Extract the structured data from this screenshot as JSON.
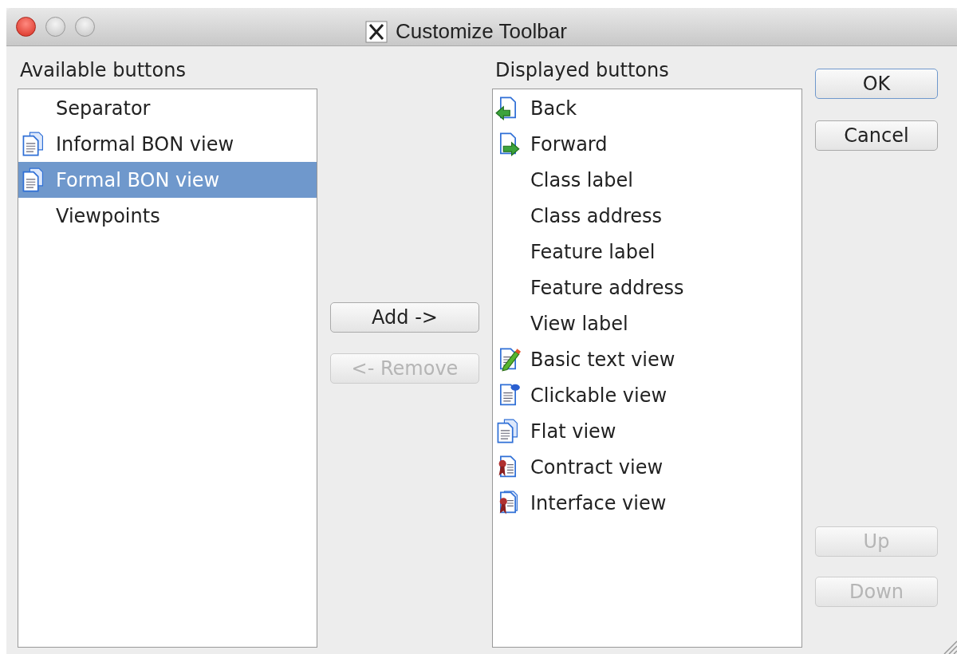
{
  "window": {
    "title": "Customize Toolbar",
    "controls": [
      {
        "kind": "close"
      },
      {
        "kind": "minimize"
      },
      {
        "kind": "zoom"
      }
    ]
  },
  "available": {
    "label": "Available buttons",
    "items": [
      {
        "label": "Separator",
        "kind": "plain",
        "selected": false
      },
      {
        "label": "Informal BON view",
        "kind": "pages",
        "selected": false
      },
      {
        "label": "Formal BON view",
        "kind": "pages",
        "selected": true
      },
      {
        "label": "Viewpoints",
        "kind": "plain",
        "selected": false
      }
    ]
  },
  "move_buttons": [
    {
      "label": "Add ->",
      "disabled": false
    },
    {
      "label": "<- Remove",
      "disabled": true
    }
  ],
  "displayed": {
    "label": "Displayed buttons",
    "items": [
      {
        "label": "Back",
        "kind": "back",
        "selected": false
      },
      {
        "label": "Forward",
        "kind": "forward",
        "selected": false
      },
      {
        "label": "Class label",
        "kind": "plain",
        "selected": false
      },
      {
        "label": "Class address",
        "kind": "plain",
        "selected": false
      },
      {
        "label": "Feature label",
        "kind": "plain",
        "selected": false
      },
      {
        "label": "Feature address",
        "kind": "plain",
        "selected": false
      },
      {
        "label": "View label",
        "kind": "plain",
        "selected": false
      },
      {
        "label": "Basic text view",
        "kind": "pencil",
        "selected": false
      },
      {
        "label": "Clickable view",
        "kind": "clickable",
        "selected": false
      },
      {
        "label": "Flat view",
        "kind": "pages",
        "selected": false
      },
      {
        "label": "Contract view",
        "kind": "contract",
        "selected": false
      },
      {
        "label": "Interface view",
        "kind": "interface",
        "selected": false
      }
    ]
  },
  "dialog_buttons": [
    {
      "label": "OK",
      "disabled": false,
      "default": true
    },
    {
      "label": "Cancel",
      "disabled": false,
      "default": false
    }
  ],
  "order_buttons": [
    {
      "label": "Up",
      "disabled": true
    },
    {
      "label": "Down",
      "disabled": true
    }
  ]
}
